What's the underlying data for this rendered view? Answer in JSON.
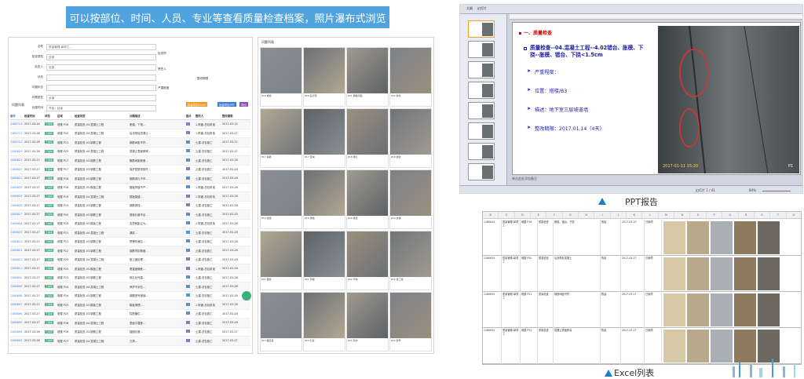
{
  "banner": "可以按部位、时间、人员、专业等查看质量检查档案，照片瀑布式浏览",
  "left_panel": {
    "form": [
      {
        "label": "名称",
        "value": "质量管理-单项工..."
      },
      {
        "label": "检查类型",
        "value": "全部"
      },
      {
        "label": "检查人",
        "value": "全部"
      },
      {
        "label": "状态",
        "value": ""
      },
      {
        "label": "问题状态",
        "value": ""
      },
      {
        "label": "问题类型",
        "value": "全部"
      },
      {
        "label": "创建时间",
        "value": "开始 - 结束"
      }
    ],
    "hints": [
      "检查项",
      "责任人",
      "整改期限",
      "严重程度"
    ],
    "table_title": "问题列表",
    "buttons": [
      "批量导出Excel",
      "批量导出PPT",
      "导出"
    ],
    "columns": [
      "编号",
      "检查时间",
      "状态",
      "区域",
      "检查类型",
      "问题描述",
      "图片",
      "整改人",
      "整改期限"
    ],
    "rows": [
      {
        "id": "1180714",
        "date": "2017-03-24",
        "status": "已销项",
        "loc": "塔楼 P18",
        "type": "质量检查-04.混凝土工程",
        "problem": "胀模、下挠...",
        "who": "1-陈晨-总包机电",
        "due": "2017-03-25"
      },
      {
        "id": "1180713",
        "date": "2017-03-26",
        "status": "已销项",
        "loc": "塔楼 P20",
        "type": "质量检查-04.混凝土工程",
        "problem": "后浇带处混凝土...",
        "who": "1-陈晨-总包机电",
        "due": "2017-03-27"
      },
      {
        "id": "1180712",
        "date": "2017-03-26",
        "status": "已销项",
        "loc": "塔楼 P21",
        "type": "质量检查-03.钢筋工程",
        "problem": "钢筋间距不符...",
        "who": "土建-总包施工",
        "due": "2017-03-27"
      },
      {
        "id": "1180624",
        "date": "2017-03-26",
        "status": "已销项",
        "loc": "塔楼 P22",
        "type": "质量检查-04.混凝土工程",
        "problem": "混凝土表面蜂窝...",
        "who": "土建-总包施工",
        "due": "2017-03-27"
      },
      {
        "id": "1180623",
        "date": "2017-03-27",
        "status": "已销项",
        "loc": "塔楼 P17",
        "type": "质量检查-03.钢筋工程",
        "problem": "箍筋间距超差...",
        "who": "土建-总包施工",
        "due": "2017-03-28"
      },
      {
        "id": "1180622",
        "date": "2017-03-27",
        "status": "已销项",
        "loc": "塔楼 P17",
        "type": "质量检查-03.钢筋工程",
        "problem": "保护层垫块缺失...",
        "who": "土建-总包施工",
        "due": "2017-03-28"
      },
      {
        "id": "1180621",
        "date": "2017-03-27",
        "status": "已销项",
        "loc": "塔楼 P18",
        "type": "质量检查-03.钢筋工程",
        "problem": "钢筋绑扎不牢...",
        "who": "土建-总包施工",
        "due": "2017-03-28"
      },
      {
        "id": "1180620",
        "date": "2017-03-27",
        "status": "已销项",
        "loc": "塔楼 P18",
        "type": "质量检查-05.模板工程",
        "problem": "模板拼缝不严...",
        "who": "1-陈晨-总包机电",
        "due": "2017-03-28"
      },
      {
        "id": "1180619",
        "date": "2017-03-27",
        "status": "已销项",
        "loc": "塔楼 P19",
        "type": "质量检查-04.混凝土工程",
        "problem": "楼板裂缝...",
        "who": "1-陈晨-总包机电",
        "due": "2017-03-28"
      },
      {
        "id": "1180618",
        "date": "2017-03-27",
        "status": "已销项",
        "loc": "塔楼 P19",
        "type": "质量检查-03.钢筋工程",
        "problem": "钢筋锈蚀...",
        "who": "土建-总包施工",
        "due": "2017-03-28"
      },
      {
        "id": "1180617",
        "date": "2017-03-27",
        "status": "已销项",
        "loc": "塔楼 P20",
        "type": "质量检查-03.钢筋工程",
        "problem": "搭接长度不足...",
        "who": "土建-总包施工",
        "due": "2017-03-28"
      },
      {
        "id": "1180616",
        "date": "2017-03-27",
        "status": "已销项",
        "loc": "塔楼 P20",
        "type": "质量检查-05.模板工程",
        "problem": "支撑间距过大...",
        "who": "1-陈晨-总包机电",
        "due": "2017-03-28"
      },
      {
        "id": "1180615",
        "date": "2017-03-27",
        "status": "已销项",
        "loc": "塔楼 P21",
        "type": "质量检查-04.混凝土工程",
        "problem": "漏浆...",
        "who": "土建-总包施工",
        "due": "2017-03-28"
      },
      {
        "id": "1180614",
        "date": "2017-03-27",
        "status": "已销项",
        "loc": "塔楼 P21",
        "type": "质量检查-03.钢筋工程",
        "problem": "预埋件偏位...",
        "who": "土建-总包施工",
        "due": "2017-03-28"
      },
      {
        "id": "1180613",
        "date": "2017-03-27",
        "status": "已销项",
        "loc": "塔楼 P22",
        "type": "质量检查-03.钢筋工程",
        "problem": "钢筋弯钩角度...",
        "who": "土建-总包施工",
        "due": "2017-03-28"
      },
      {
        "id": "1180612",
        "date": "2017-03-27",
        "status": "已销项",
        "loc": "塔楼 P22",
        "type": "质量检查-04.混凝土工程",
        "problem": "施工缝处理...",
        "who": "土建-总包施工",
        "due": "2017-03-28"
      },
      {
        "id": "1180611",
        "date": "2017-03-27",
        "status": "已销项",
        "loc": "塔楼 P23",
        "type": "质量检查-05.模板工程",
        "problem": "垂直度偏差...",
        "who": "1-陈晨-总包机电",
        "due": "2017-03-28"
      },
      {
        "id": "1180610",
        "date": "2017-03-27",
        "status": "已销项",
        "loc": "塔楼 P23",
        "type": "质量检查-03.钢筋工程",
        "problem": "绑扎丝外露...",
        "who": "土建-总包施工",
        "due": "2017-03-28"
      },
      {
        "id": "1180609",
        "date": "2017-03-27",
        "status": "已销项",
        "loc": "塔楼 P24",
        "type": "质量检查-04.混凝土工程",
        "problem": "养护不到位...",
        "who": "土建-总包施工",
        "due": "2017-03-28"
      },
      {
        "id": "1180608",
        "date": "2017-03-27",
        "status": "已销项",
        "loc": "塔楼 P24",
        "type": "质量检查-03.钢筋工程",
        "problem": "钢筋型号错误...",
        "who": "土建-总包施工",
        "due": "2017-03-28"
      },
      {
        "id": "1180607",
        "date": "2017-03-27",
        "status": "已销项",
        "loc": "塔楼 P25",
        "type": "质量检查-05.模板工程",
        "problem": "模板清理...",
        "who": "1-陈晨-总包机电",
        "due": "2017-03-28"
      },
      {
        "id": "1180606",
        "date": "2017-03-27",
        "status": "已销项",
        "loc": "塔楼 P25",
        "type": "质量检查-03.钢筋工程",
        "problem": "柱筋偏位...",
        "who": "土建-总包施工",
        "due": "2017-03-28"
      },
      {
        "id": "1180605",
        "date": "2017-03-27",
        "status": "已销项",
        "loc": "塔楼 P26",
        "type": "质量检查-04.混凝土工程",
        "problem": "表面平整度...",
        "who": "土建-总包施工",
        "due": "2017-03-28"
      },
      {
        "id": "1180604",
        "date": "2017-03-26",
        "status": "已销项",
        "loc": "塔楼 P26",
        "type": "质量检查-03.钢筋工程",
        "problem": "锚固长度...",
        "who": "土建-总包施工",
        "due": "2017-03-27"
      },
      {
        "id": "1180603",
        "date": "2017-03-26",
        "status": "已销项",
        "loc": "塔楼 P27",
        "type": "质量检查-04.混凝土工程",
        "problem": "孔洞...",
        "who": "土建-总包施工",
        "due": "2017-03-27"
      }
    ]
  },
  "grid_panel": {
    "title": "问题列表",
    "captions": [
      "P18 胀模",
      "P20 后浇带",
      "P21 钢筋间距",
      "P22 蜂窝",
      "P17 箍筋",
      "P17 垫块",
      "P18 绑扎",
      "P18 拼缝",
      "P19 裂缝",
      "P19 锈蚀",
      "P20 搭接",
      "P20 支撑",
      "P21 漏浆",
      "P21 预埋",
      "P22 弯钩",
      "P22 施工缝",
      "P23 垂直度",
      "P23 扎丝",
      "P24 养护",
      "P24 型号"
    ]
  },
  "ppt": {
    "tabs": [
      "大纲",
      "幻灯片"
    ],
    "slide_head": "一、质量检查",
    "slide_title": "质量检查--04.混凝土工程--4.02错台、胀模、下挠--胀模、错台、下挠<1.5cm",
    "items": [
      "严重程度：",
      "位置：塔楼/B3",
      "描述：地下室三层坡道墙",
      "整改期限：2017.01.14（4天）"
    ],
    "photo_stamp": "2017-01-11 15:20",
    "photo_label": "P1",
    "notes": "单击此处添加备注",
    "status_left": "幻灯片 1 / 41",
    "zoom": "84%",
    "slide_count": 8
  },
  "captions": {
    "ppt": "PPT报告",
    "excel": "Excel列表"
  },
  "excel": {
    "columns": [
      "B",
      "C",
      "D",
      "E",
      "F",
      "G",
      "H",
      "I",
      "J",
      "K",
      "L",
      "M",
      "N",
      "O",
      "P",
      "Q",
      "R",
      "S",
      "T",
      "U"
    ],
    "rows": [
      {
        "id": "1180615",
        "place": "质量管理-单项工",
        "loc": "塔楼 P18",
        "type": "质量检查",
        "desc": "胀模、错台、下挠",
        "who": "陈晨",
        "date": "2017-03-25",
        "status": "已销项"
      },
      {
        "id": "1180634",
        "place": "质量管理-单项工",
        "loc": "塔楼 P20",
        "type": "质量检查",
        "desc": "后浇带处混凝土",
        "who": "陈晨",
        "date": "2017-03-27",
        "status": "已销项"
      },
      {
        "id": "1180633",
        "place": "质量管理-单项工",
        "loc": "塔楼 P21",
        "type": "质量检查",
        "desc": "钢筋间距不符",
        "who": "陈晨",
        "date": "2017-03-27",
        "status": "已销项"
      },
      {
        "id": "1180632",
        "place": "质量管理-单项工",
        "loc": "塔楼 P22",
        "type": "质量检查",
        "desc": "混凝土表面蜂窝",
        "who": "陈晨",
        "date": "2017-03-27",
        "status": "已销项"
      }
    ]
  },
  "colors": {
    "banner": "#4fa3df",
    "accent_green": "#3ab07a",
    "btn_orange": "#f19a2e",
    "btn_blue": "#3b7dd8",
    "btn_purple": "#8a4fbf",
    "ppt_red": "#cc0000",
    "ppt_text": "#1a1aa0",
    "arrow_blue": "#1f7fc8"
  }
}
